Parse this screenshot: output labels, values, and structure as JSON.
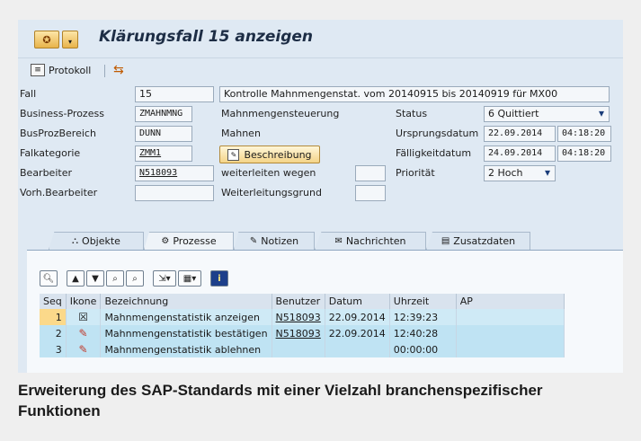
{
  "window": {
    "title": "Klärungsfall 15 anzeigen"
  },
  "toolbar": {
    "protokoll_label": "Protokoll",
    "export_icon": "export-icon"
  },
  "form": {
    "fall_label": "Fall",
    "fall_value": "15",
    "fall_description": "Kontrolle Mahnmengenstat. vom 20140915 bis 20140919 für MX00",
    "geschaeftsprozess_label": "Business-Prozess",
    "geschaeftsprozess_value": "ZMAHNMNG",
    "geschaeftsprozess_text": "Mahnmengensteuerung",
    "status_label": "Status",
    "status_value": "6 Quittiert",
    "busprozbereich_label": "BusProzBereich",
    "busprozbereich_value": "DUNN",
    "busprozbereich_text": "Mahnen",
    "ursprungsdatum_label": "Ursprungsdatum",
    "ursprungsdatum_date": "22.09.2014",
    "ursprungsdatum_time": "04:18:20",
    "falkategorie_label": "Falkategorie",
    "falkategorie_value": "ZMM1",
    "beschreibung_label": "Beschreibung",
    "faelligkeitdatum_label": "Fälligkeitdatum",
    "faelligkeitdatum_date": "24.09.2014",
    "faelligkeitdatum_time": "04:18:20",
    "bearbeiter_label": "Bearbeiter",
    "bearbeiter_value": "N518093",
    "weiterleiten_label": "weiterleiten wegen",
    "prioritaet_label": "Priorität",
    "prioritaet_value": "2 Hoch",
    "vorh_bearbeiter_label": "Vorh.Bearbeiter",
    "weiterleitungsgrund_label": "Weiterleitungsgrund"
  },
  "tabs": [
    {
      "label": "Objekte",
      "icon": "objects-icon"
    },
    {
      "label": "Prozesse",
      "icon": "processes-icon"
    },
    {
      "label": "Notizen",
      "icon": "notes-icon"
    },
    {
      "label": "Nachrichten",
      "icon": "mail-icon"
    },
    {
      "label": "Zusatzdaten",
      "icon": "additional-data-icon"
    }
  ],
  "grid": {
    "columns": [
      "Seq",
      "Ikone",
      "Bezeichnung",
      "Benutzer",
      "Datum",
      "Uhrzeit",
      "AP"
    ],
    "rows": [
      {
        "seq": "1",
        "icon": "done-icon",
        "bezeichnung": "Mahnmengenstatistik anzeigen",
        "benutzer": "N518093",
        "datum": "22.09.2014",
        "uhrzeit": "12:39:23",
        "ap": ""
      },
      {
        "seq": "2",
        "icon": "edit-done-icon",
        "bezeichnung": "Mahnmengenstatistik bestätigen",
        "benutzer": "N518093",
        "datum": "22.09.2014",
        "uhrzeit": "12:40:28",
        "ap": ""
      },
      {
        "seq": "3",
        "icon": "edit-reject-icon",
        "bezeichnung": "Mahnmengenstatistik ablehnen",
        "benutzer": "",
        "datum": "",
        "uhrzeit": "00:00:00",
        "ap": ""
      }
    ]
  },
  "caption": "Erweiterung des SAP-Standards mit einer Vielzahl branchenspezifischer Funktionen"
}
